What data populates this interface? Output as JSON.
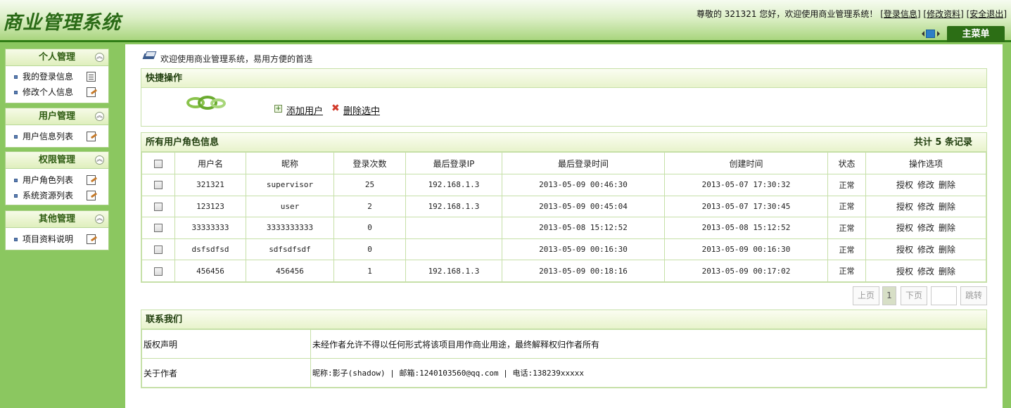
{
  "header": {
    "app_title": "商业管理系统",
    "greeting": "尊敬的 321321 您好，欢迎使用商业管理系统！",
    "link_login_info": "登录信息",
    "link_edit_profile": "修改资料",
    "link_logout": "安全退出",
    "main_menu_label": "主菜单"
  },
  "sidebar": {
    "groups": [
      {
        "title": "个人管理",
        "items": [
          "我的登录信息",
          "修改个人信息"
        ]
      },
      {
        "title": "用户管理",
        "items": [
          "用户信息列表"
        ]
      },
      {
        "title": "权限管理",
        "items": [
          "用户角色列表",
          "系统资源列表"
        ]
      },
      {
        "title": "其他管理",
        "items": [
          "项目资料说明"
        ]
      }
    ]
  },
  "main": {
    "welcome": "欢迎使用商业管理系统，易用方便的首选",
    "quick": {
      "title": "快捷操作",
      "add_user": "添加用户",
      "delete_selected": "删除选中"
    },
    "users": {
      "title": "所有用户角色信息",
      "count_text": "共计 5 条记录",
      "columns": [
        "用户名",
        "昵称",
        "登录次数",
        "最后登录IP",
        "最后登录时间",
        "创建时间",
        "状态",
        "操作选项"
      ],
      "rows": [
        {
          "username": "321321",
          "nickname": "supervisor",
          "logins": "25",
          "ip": "192.168.1.3",
          "last_login": "2013-05-09 00:46:30",
          "created": "2013-05-07 17:30:32",
          "status": "正常"
        },
        {
          "username": "123123",
          "nickname": "user",
          "logins": "2",
          "ip": "192.168.1.3",
          "last_login": "2013-05-09 00:45:04",
          "created": "2013-05-07 17:30:45",
          "status": "正常"
        },
        {
          "username": "33333333",
          "nickname": "3333333333",
          "logins": "0",
          "ip": "",
          "last_login": "2013-05-08 15:12:52",
          "created": "2013-05-08 15:12:52",
          "status": "正常"
        },
        {
          "username": "dsfsdfsd",
          "nickname": "sdfsdfsdf",
          "logins": "0",
          "ip": "",
          "last_login": "2013-05-09 00:16:30",
          "created": "2013-05-09 00:16:30",
          "status": "正常"
        },
        {
          "username": "456456",
          "nickname": "456456",
          "logins": "1",
          "ip": "192.168.1.3",
          "last_login": "2013-05-09 00:18:16",
          "created": "2013-05-09 00:17:02",
          "status": "正常"
        }
      ],
      "ops": [
        "授权",
        "修改",
        "删除"
      ]
    },
    "pager": {
      "prev": "上页",
      "current": "1",
      "next": "下页",
      "jump": "跳转",
      "jump_value": ""
    },
    "contact": {
      "title": "联系我们",
      "copyright_label": "版权声明",
      "copyright_text": "未经作者允许不得以任何形式将该项目用作商业用途，最终解释权归作者所有",
      "author_label": "关于作者",
      "author_text": "昵称:影子(shadow) | 邮箱:1240103560@qq.com | 电话:138239xxxxx"
    }
  }
}
